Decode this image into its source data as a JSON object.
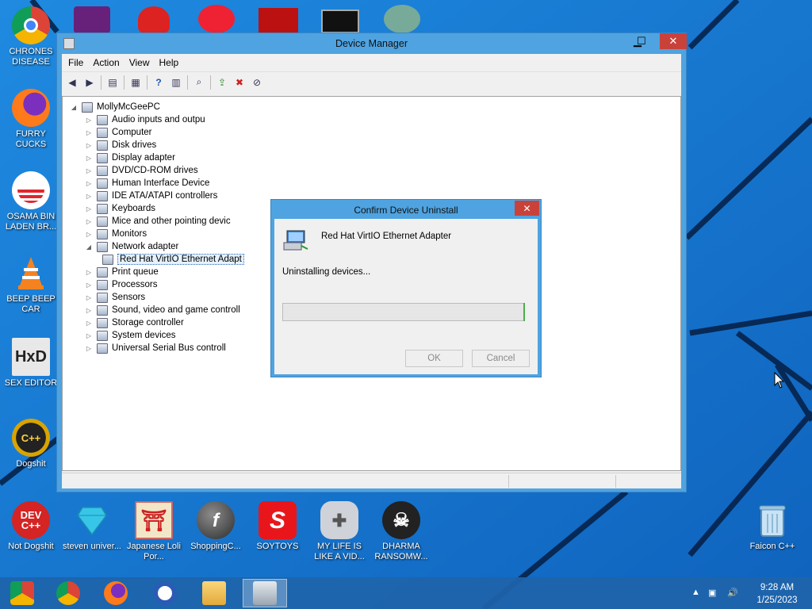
{
  "desktop": {
    "icons_left": [
      {
        "id": "chrome",
        "label": "CHRONES DISEASE",
        "icon": "chrome-icon"
      },
      {
        "id": "firefox",
        "label": "FURRY CUCKS",
        "icon": "firefox-icon"
      },
      {
        "id": "obama",
        "label": "OSAMA BIN LADEN BR...",
        "icon": "obama-logo-icon"
      },
      {
        "id": "vlc",
        "label": "BEEP BEEP CAR",
        "icon": "vlc-cone-icon"
      },
      {
        "id": "hxd",
        "label": "SEX EDITOR",
        "icon": "hxd-icon"
      },
      {
        "id": "dogshit",
        "label": "Dogshit",
        "icon": "cpp-ide-icon"
      }
    ],
    "icons_bottom": [
      {
        "id": "devcpp",
        "label": "Not Dogshit",
        "icon": "devcpp-icon"
      },
      {
        "id": "steven",
        "label": "steven univer...",
        "icon": "diamond-icon"
      },
      {
        "id": "japanese",
        "label": "Japanese Loli Por...",
        "icon": "torii-icon"
      },
      {
        "id": "shopping",
        "label": "ShoppingC...",
        "icon": "flash-icon"
      },
      {
        "id": "soytoys",
        "label": "SOYTOYS",
        "icon": "s-logo-icon"
      },
      {
        "id": "mylife",
        "label": "MY LIFE IS LIKE A VID...",
        "icon": "gamepad-icon"
      },
      {
        "id": "dharma",
        "label": "DHARMA RANSOMW...",
        "icon": "skull-icon"
      }
    ],
    "recycle_bin_label": "Faicon C++"
  },
  "device_manager": {
    "title": "Device Manager",
    "menus": [
      "File",
      "Action",
      "View",
      "Help"
    ],
    "tree": {
      "root": "MollyMcGeePC",
      "nodes": [
        {
          "label": "Audio inputs and outpu",
          "expanded": false
        },
        {
          "label": "Computer",
          "expanded": false
        },
        {
          "label": "Disk drives",
          "expanded": false
        },
        {
          "label": "Display adapter",
          "expanded": false
        },
        {
          "label": "DVD/CD-ROM drives",
          "expanded": false
        },
        {
          "label": "Human Interface Device",
          "expanded": false
        },
        {
          "label": "IDE ATA/ATAPI controllers",
          "expanded": false
        },
        {
          "label": "Keyboards",
          "expanded": false
        },
        {
          "label": "Mice and other pointing devic",
          "expanded": false
        },
        {
          "label": "Monitors",
          "expanded": false
        },
        {
          "label": "Network adapter",
          "expanded": true
        },
        {
          "label": "Red Hat VirtIO Ethernet Adapt",
          "child": true,
          "selected": true
        },
        {
          "label": "Print queue",
          "expanded": false
        },
        {
          "label": "Processors",
          "expanded": false
        },
        {
          "label": "Sensors",
          "expanded": false
        },
        {
          "label": "Sound, video and game controll",
          "expanded": false
        },
        {
          "label": "Storage controller",
          "expanded": false
        },
        {
          "label": "System devices",
          "expanded": false
        },
        {
          "label": "Universal Serial Bus controll",
          "expanded": false
        }
      ]
    }
  },
  "dialog": {
    "title": "Confirm Device Uninstall",
    "device_name": "Red Hat VirtIO Ethernet Adapter",
    "status": "Uninstalling devices...",
    "progress": 0,
    "ok_label": "OK",
    "cancel_label": "Cancel"
  },
  "taskbar": {
    "time": "9:28 AM",
    "date": "1/25/2023",
    "apps": [
      "start-orb-icon",
      "chrome-icon",
      "firefox-icon",
      "obama-logo-icon",
      "file-explorer-icon",
      "device-manager-icon"
    ]
  },
  "colors": {
    "titlebar": "#4fa3e0",
    "close_red": "#c9423a",
    "progress_green": "#06b025",
    "desktop_blue": "#1a78d4"
  }
}
